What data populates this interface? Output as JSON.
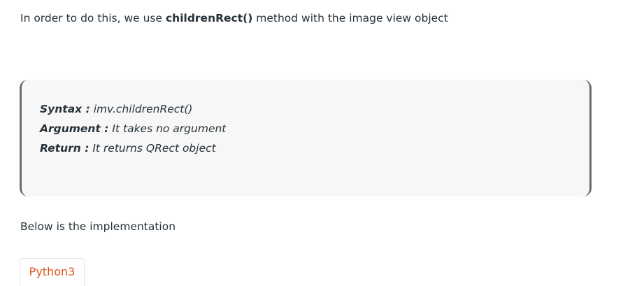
{
  "intro": {
    "before": "In order to do this, we use ",
    "method": "childrenRect()",
    "after": " method with the image view object"
  },
  "syntax": {
    "syntax_label": "Syntax :",
    "syntax_value": " imv.childrenRect()",
    "argument_label": "Argument :",
    "argument_value": " It takes no argument",
    "return_label": "Return :",
    "return_value": " It returns QRect object"
  },
  "below_text": "Below is the implementation",
  "tabs": [
    {
      "label": "Python3",
      "active": true
    }
  ],
  "colors": {
    "text": "#273239",
    "box_background": "#f7f7f7",
    "box_border": "#6b6b6b",
    "tab_accent": "#e0541d"
  }
}
